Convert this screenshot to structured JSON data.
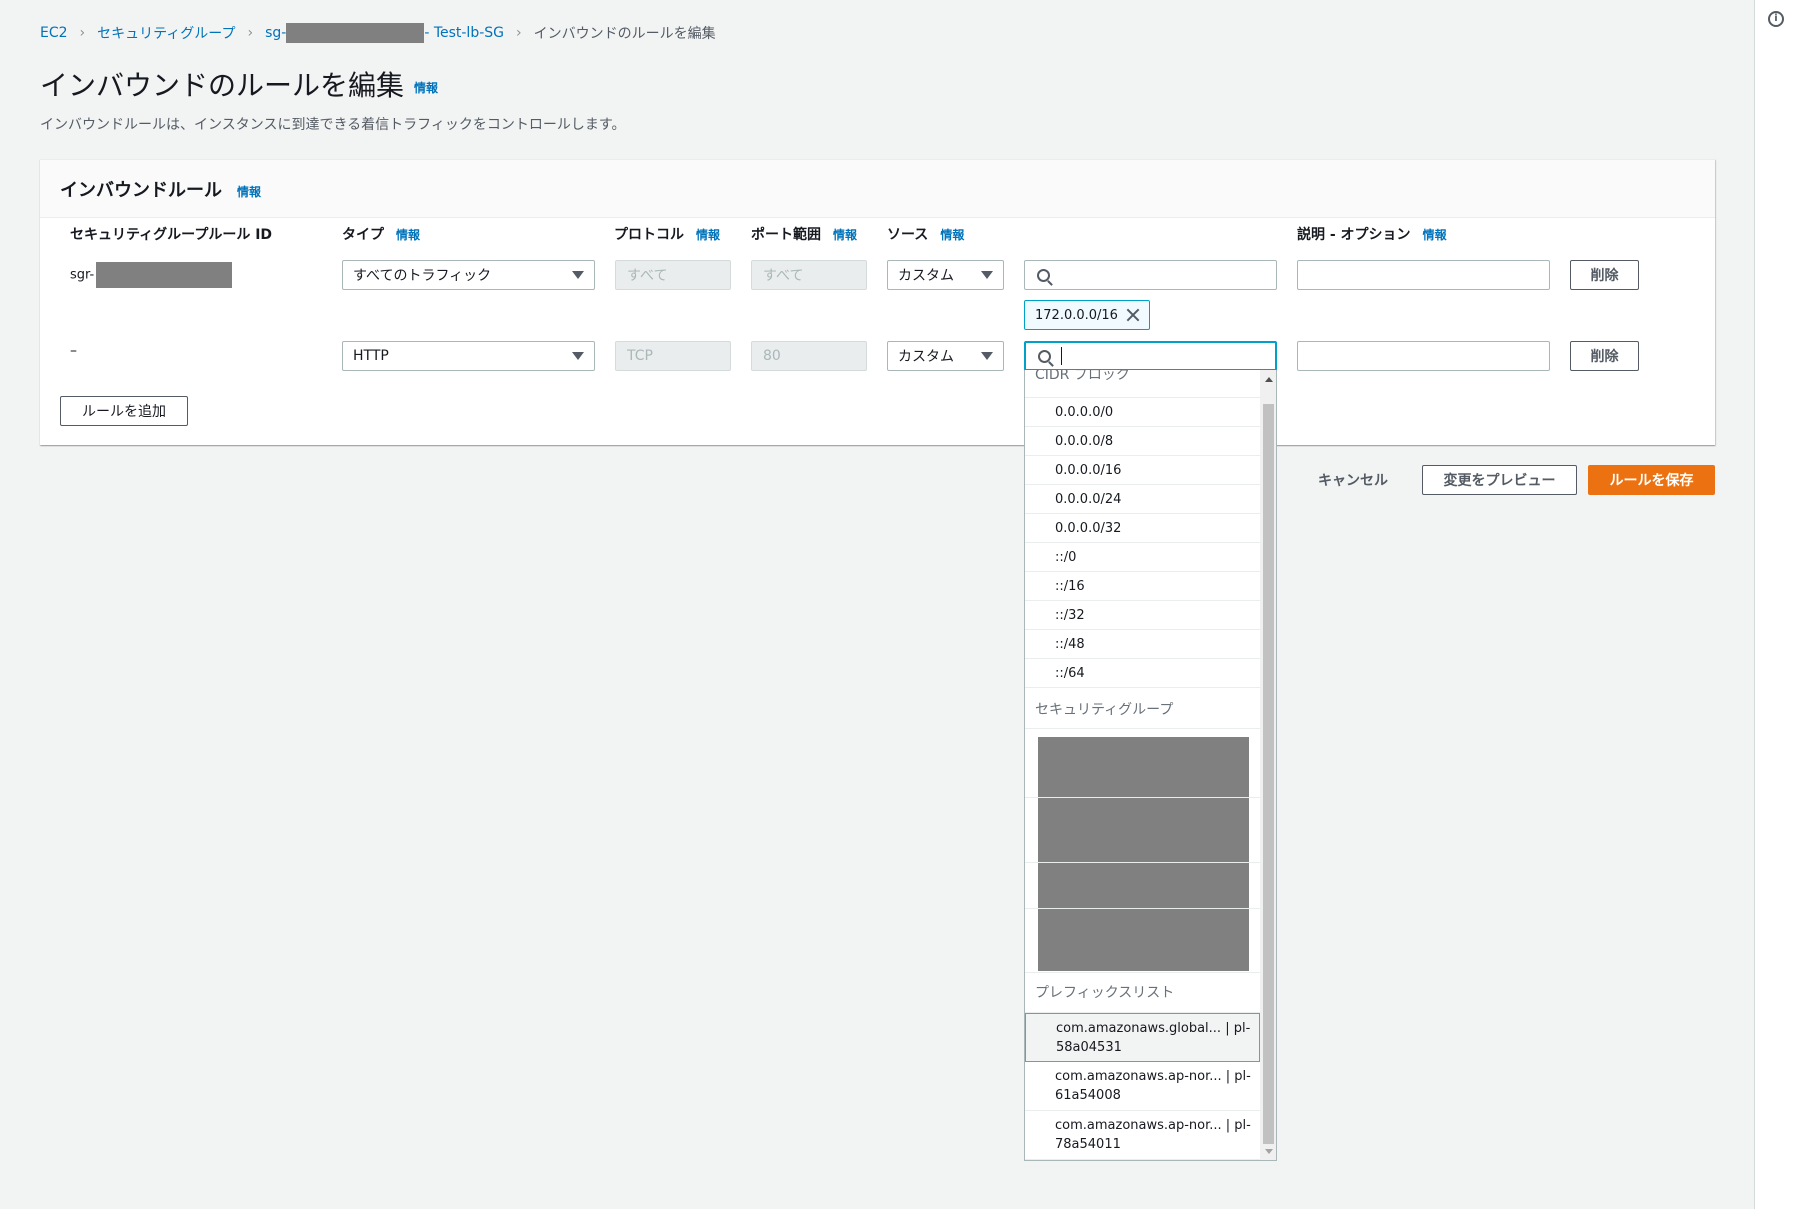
{
  "breadcrumb": {
    "ec2": "EC2",
    "security_groups": "セキュリティグループ",
    "sg_prefix": "sg-",
    "sg_suffix": "- Test-lb-SG",
    "current": "インバウンドのルールを編集"
  },
  "page": {
    "title": "インバウンドのルールを編集",
    "info": "情報",
    "description": "インバウンドルールは、インスタンスに到達できる着信トラフィックをコントロールします。"
  },
  "panel": {
    "title": "インバウンドルール",
    "info": "情報",
    "columns": {
      "rule_id": "セキュリティグループルール ID",
      "type": "タイプ",
      "protocol": "プロトコル",
      "port_range": "ポート範囲",
      "source": "ソース",
      "description": "説明 - オプション",
      "info": "情報"
    },
    "rows": [
      {
        "rule_id": "sgr-",
        "type": "すべてのトラフィック",
        "protocol": "すべて",
        "port_range": "すべて",
        "source_type": "カスタム",
        "source_value": "",
        "token": "172.0.0.0/16",
        "description": "",
        "delete": "削除"
      },
      {
        "rule_id": "–",
        "type": "HTTP",
        "protocol": "TCP",
        "port_range": "80",
        "source_type": "カスタム",
        "source_value": "",
        "description": "",
        "delete": "削除"
      }
    ],
    "add_rule": "ルールを追加"
  },
  "actions": {
    "cancel": "キャンセル",
    "preview": "変更をプレビュー",
    "save": "ルールを保存"
  },
  "dropdown": {
    "cidr_group": "CIDR ブロック",
    "cidr_items": [
      "0.0.0.0/0",
      "0.0.0.0/8",
      "0.0.0.0/16",
      "0.0.0.0/24",
      "0.0.0.0/32",
      "::/0",
      "::/16",
      "::/32",
      "::/48",
      "::/64"
    ],
    "sg_group": "セキュリティグループ",
    "prefix_group": "プレフィックスリスト",
    "prefix_items": [
      {
        "line1": "com.amazonaws.global... | pl-",
        "line2": "58a04531"
      },
      {
        "line1": "com.amazonaws.ap-nor... | pl-",
        "line2": "61a54008"
      },
      {
        "line1": "com.amazonaws.ap-nor... | pl-",
        "line2": "78a54011"
      }
    ]
  },
  "colors": {
    "link": "#0073bb",
    "primary": "#ec7211",
    "focus": "#00a1c9"
  }
}
